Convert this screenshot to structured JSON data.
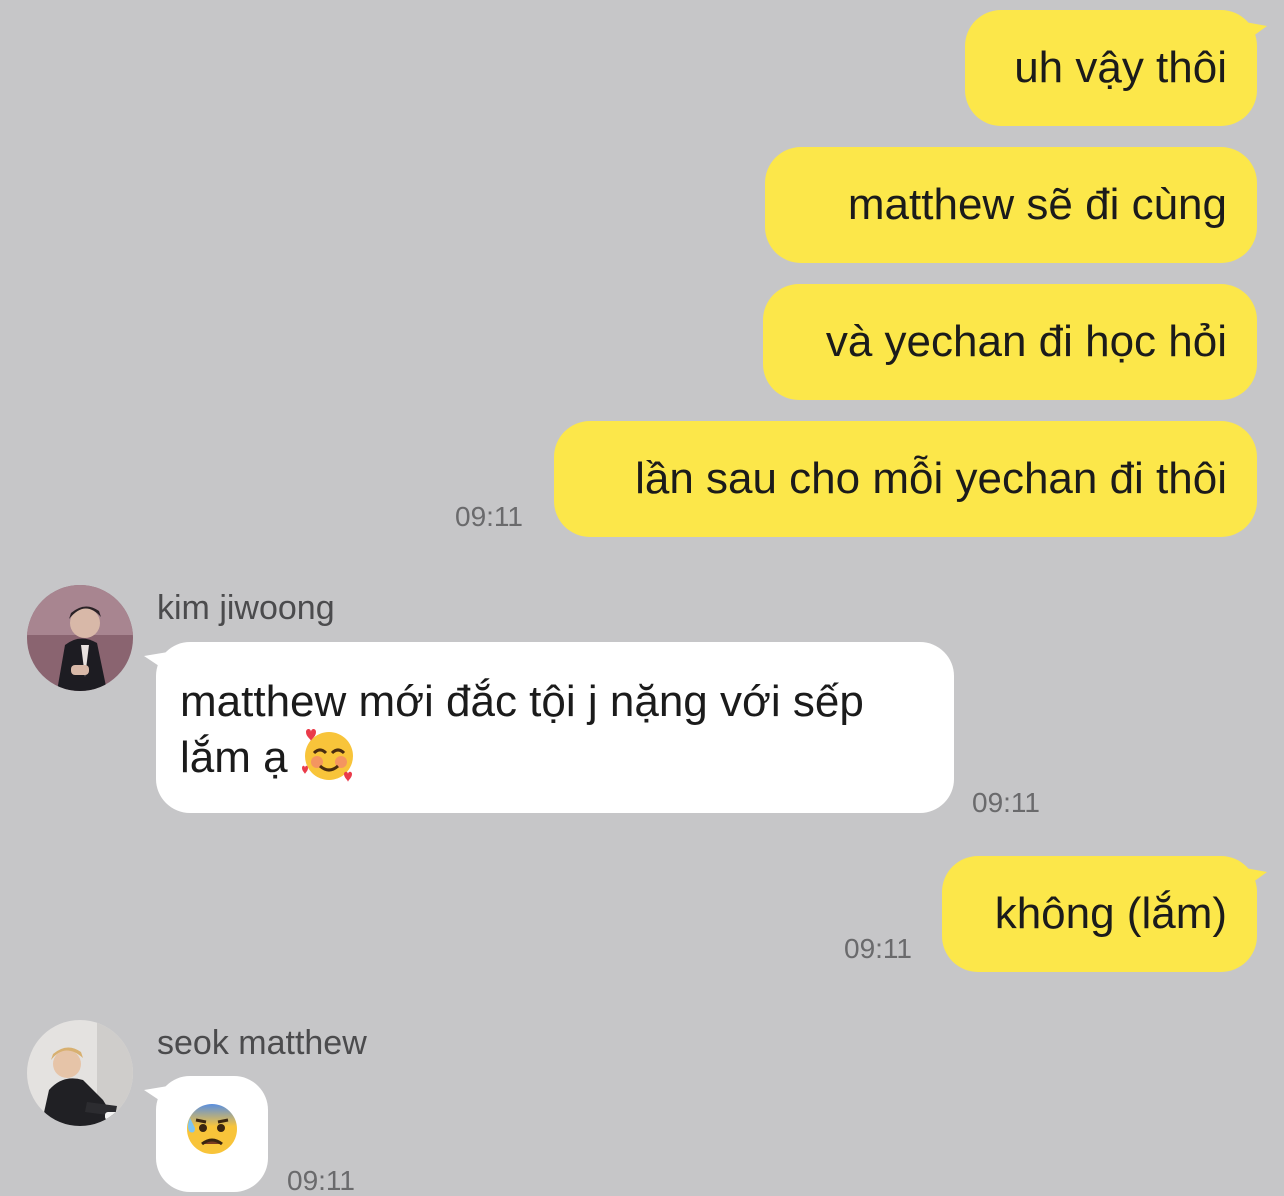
{
  "outgoing": [
    {
      "text": "uh vậy thôi"
    },
    {
      "text": "matthew sẽ đi cùng"
    },
    {
      "text": "và yechan đi học hỏi"
    },
    {
      "text": "lần sau cho mỗi yechan đi thôi"
    }
  ],
  "outgoing_time_1": "09:11",
  "message_jiwoong": {
    "sender": "kim jiwoong",
    "text": "matthew mới đắc tội j nặng với sếp lắm ạ",
    "emoji": "smiling-face-with-hearts",
    "time": "09:11"
  },
  "reply_khong": {
    "text": "không (lắm)",
    "time": "09:11"
  },
  "message_matthew": {
    "sender": "seok matthew",
    "emoji": "anxious-face-with-sweat",
    "time": "09:11"
  },
  "colors": {
    "background": "#c6c6c8",
    "outgoing_bubble": "#fce74a",
    "incoming_bubble": "#ffffff"
  }
}
